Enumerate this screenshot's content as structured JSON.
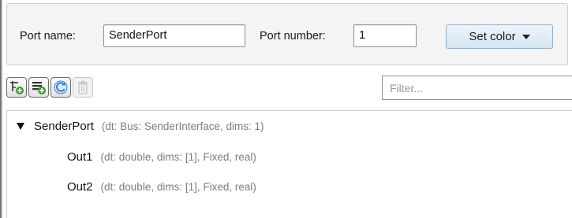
{
  "port": {
    "name_label": "Port name:",
    "name_value": "SenderPort",
    "number_label": "Port number:",
    "number_value": "1",
    "set_color_label": "Set color"
  },
  "toolbar": {
    "buttons": [
      {
        "name": "add-element-button",
        "icon": "add-element-icon"
      },
      {
        "name": "add-data-element-button",
        "icon": "add-list-icon"
      },
      {
        "name": "refresh-button",
        "icon": "refresh-icon"
      },
      {
        "name": "delete-button",
        "icon": "trash-icon",
        "disabled": true
      }
    ],
    "filter_placeholder": "Filter..."
  },
  "tree": {
    "root": {
      "name": "SenderPort",
      "desc": "(dt: Bus: SenderInterface, dims: 1)",
      "expanded": true
    },
    "children": [
      {
        "name": "Out1",
        "desc": "(dt: double, dims: [1], Fixed, real)"
      },
      {
        "name": "Out2",
        "desc": "(dt: double, dims: [1], Fixed, real)"
      }
    ]
  },
  "colors": {
    "accent_blue": "#3a7fd0",
    "add_green": "#3c9a2e",
    "desc_gray": "#7d7d7d"
  }
}
